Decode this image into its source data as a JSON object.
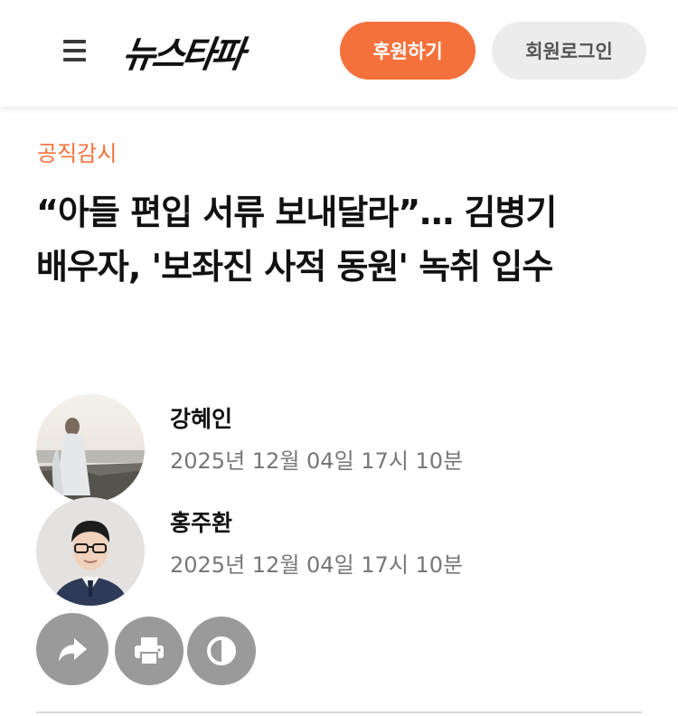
{
  "header": {
    "logo_text": "뉴스타파",
    "donate_label": "후원하기",
    "login_label": "회원로그인",
    "menu_icon": "hamburger-menu-icon"
  },
  "article": {
    "category": "공직감시",
    "title": "“아들 편입 서류 보내달라”… 김병기 배우자, '보좌진 사적 동원' 녹취 입수",
    "authors": [
      {
        "name": "강혜인",
        "date": "2025년 12월 04일 17시 10분"
      },
      {
        "name": "홍주환",
        "date": "2025년 12월 04일 17시 10분"
      }
    ]
  },
  "actions": {
    "share_icon": "share-icon",
    "print_icon": "print-icon",
    "contrast_icon": "contrast-icon"
  },
  "colors": {
    "accent": "#f4713c",
    "login_bg": "#ececec",
    "action_bg": "#9a9a9a",
    "meta_text": "#777777"
  }
}
